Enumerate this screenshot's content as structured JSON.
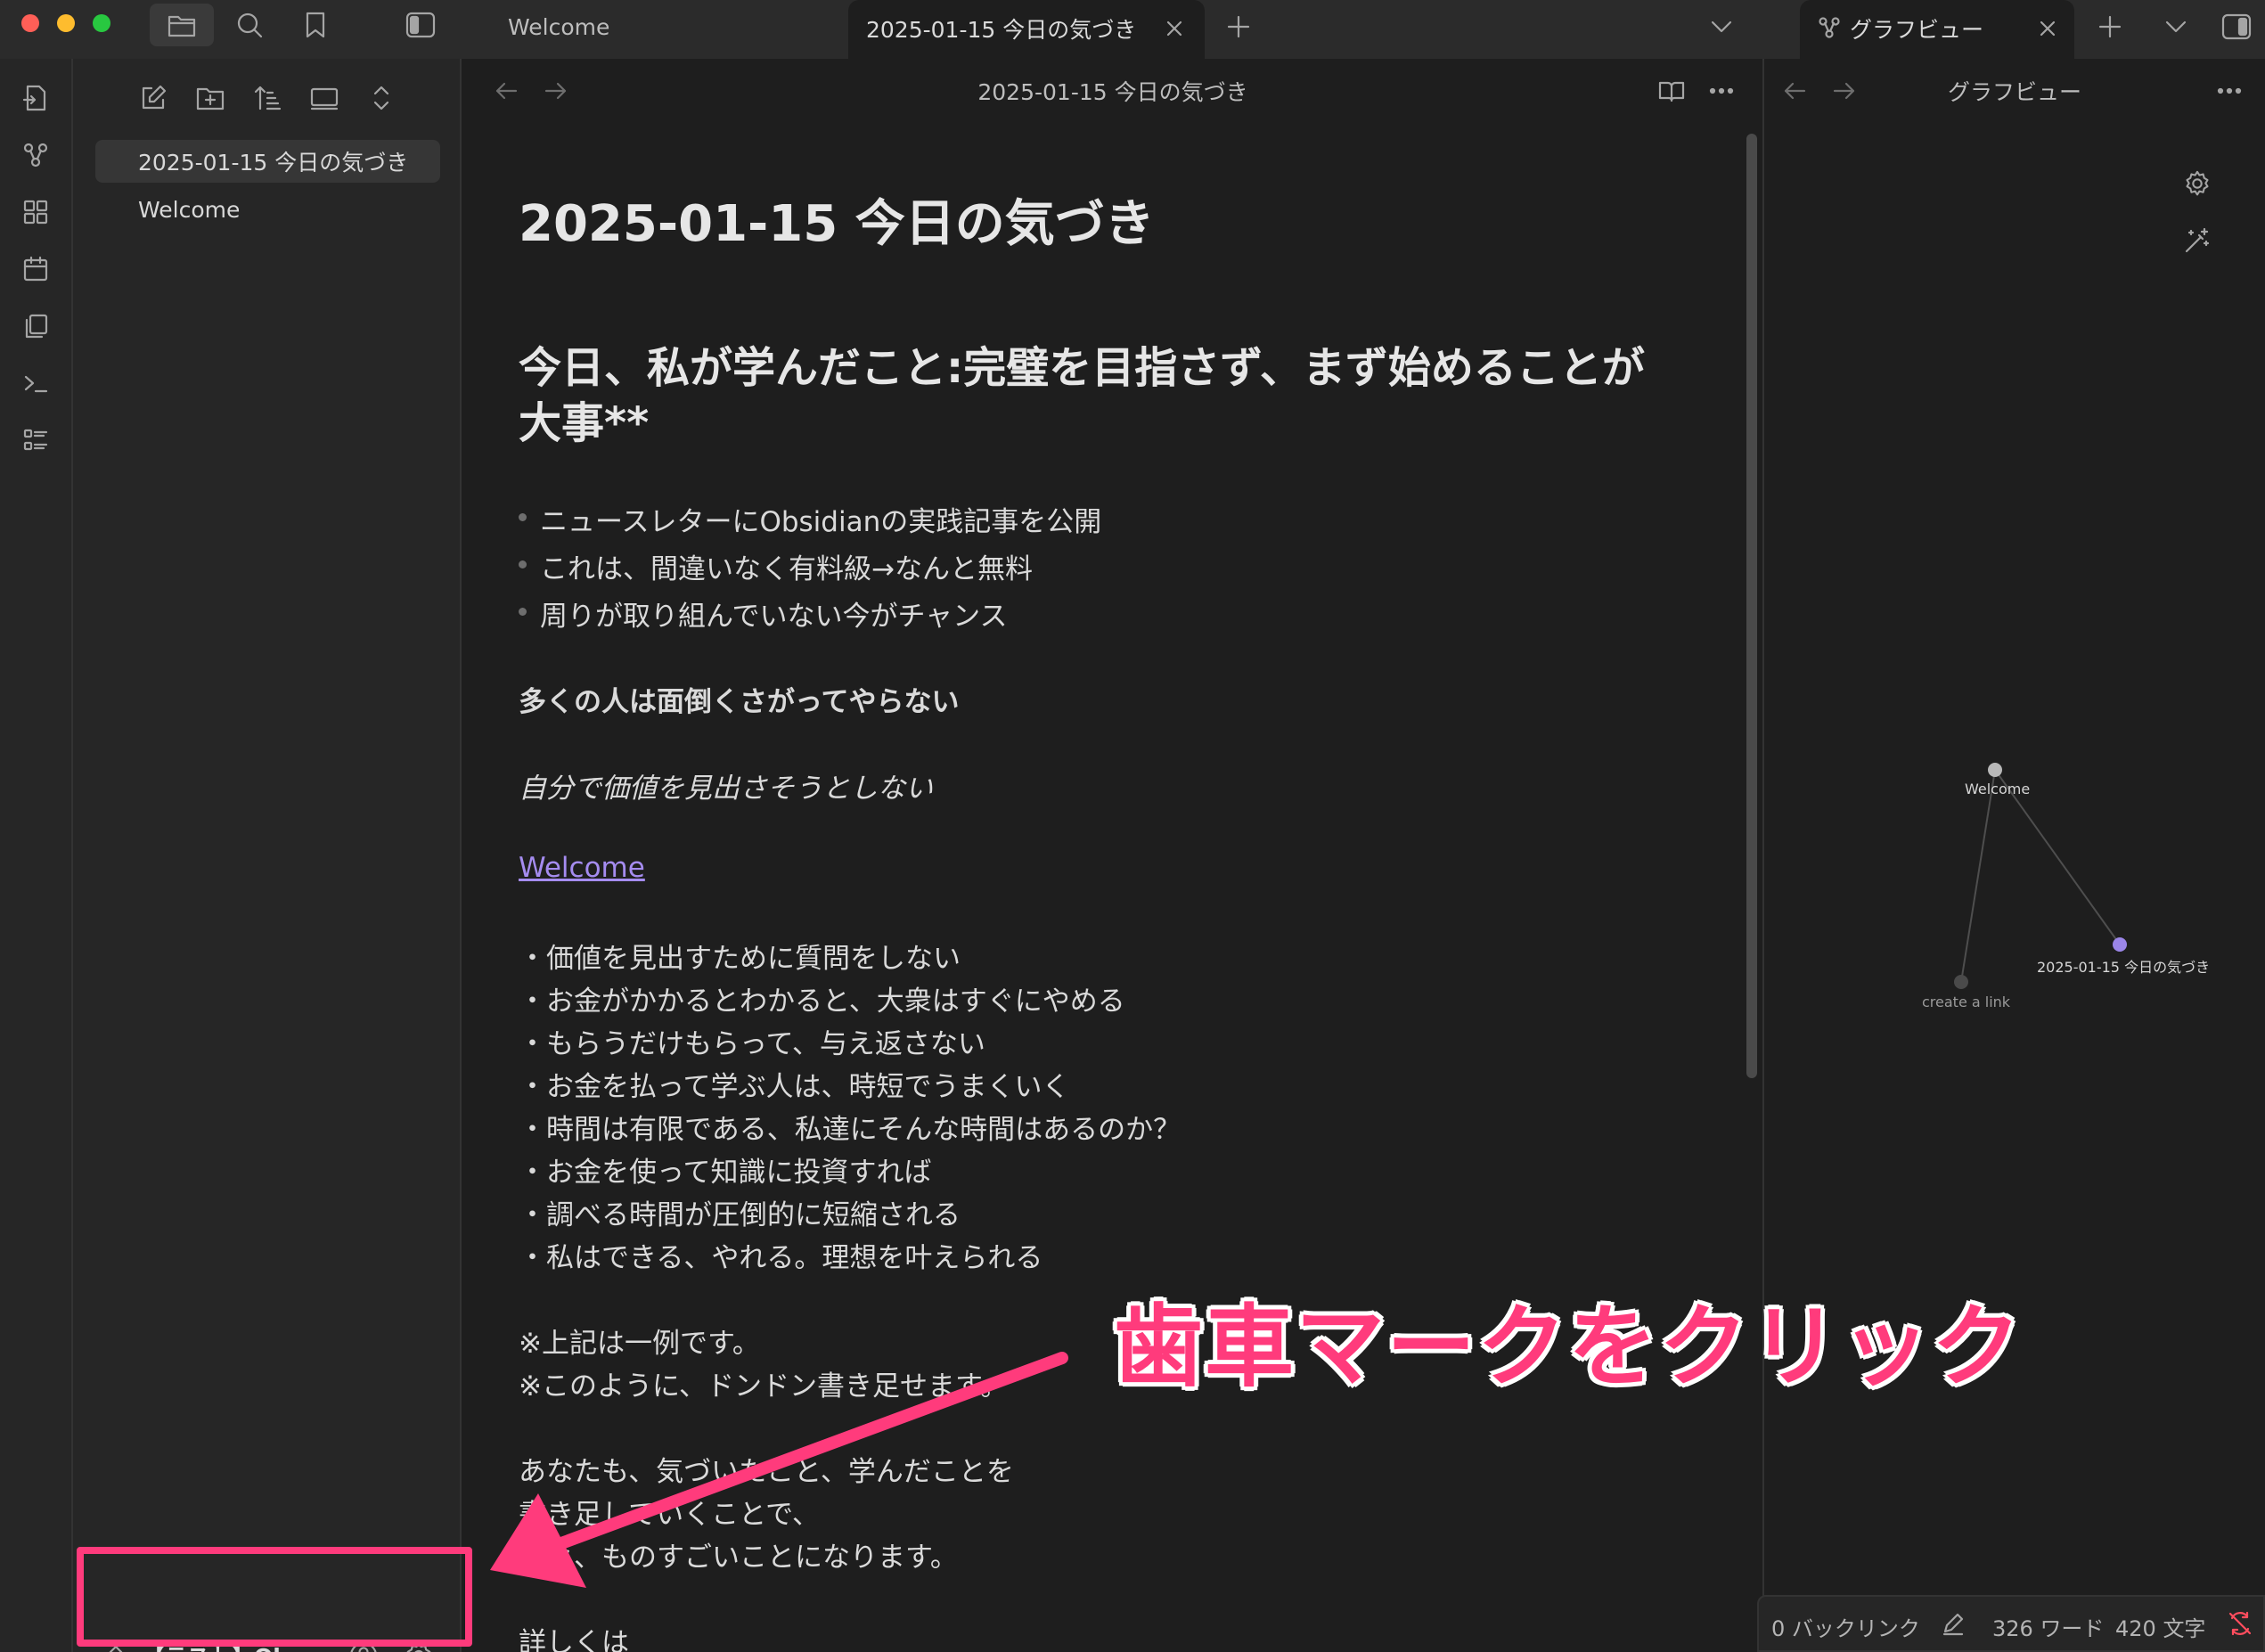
{
  "titlebar": {
    "tabs": [
      {
        "label": "Welcome"
      },
      {
        "label": "2025-01-15 今日の気づき"
      }
    ],
    "graph_tab": {
      "label": "グラフビュー"
    }
  },
  "explorer": {
    "files": [
      {
        "name": "2025-01-15 今日の気づき"
      },
      {
        "name": "Welcome"
      }
    ],
    "vault_name": "【テスト】Ob..."
  },
  "editor": {
    "header_title": "2025-01-15 今日の気づき",
    "h1": "2025-01-15 今日の気づき",
    "h2": "今日、私が学んだこと:完璧を目指さず、まず始めることが大事**",
    "bullets": [
      "ニュースレターにObsidianの実践記事を公開",
      "これは、間違いなく有料級→なんと無料",
      "周りが取り組んでいない今がチャンス"
    ],
    "bold_line": "多くの人は面倒くさがってやらない",
    "italic_line": "自分で価値を見出さそうとしない",
    "link_text": "Welcome",
    "points": [
      "・価値を見出すために質問をしない",
      "・お金がかかるとわかると、大衆はすぐにやめる",
      "・もらうだけもらって、与え返さない",
      "・お金を払って学ぶ人は、時短でうまくいく",
      "・時間は有限である、私達にそんな時間はあるのか？",
      "・お金を使って知識に投資すれば",
      "・調べる時間が圧倒的に短縮される",
      "・私はできる、やれる。理想を叶えられる"
    ],
    "notes": [
      "※上記は一例です。",
      "※このように、ドンドン書き足せます。"
    ],
    "closing": [
      "あなたも、気づいたこと、学んだことを",
      "書き足していくことで、",
      "後々、ものすごいことになります。"
    ],
    "tail": "詳しくは"
  },
  "graph": {
    "header_title": "グラフビュー",
    "nodes": [
      {
        "label": "Welcome"
      },
      {
        "label": "2025-01-15 今日の気づき"
      },
      {
        "label": "create a link"
      }
    ]
  },
  "status": {
    "backlinks": "0 バックリンク",
    "words": "326 ワード",
    "chars": "420 文字"
  },
  "annotation": {
    "callout": "歯車マークをクリック"
  },
  "colors": {
    "accent": "#a58cf0",
    "annotation": "#ff3b7c",
    "background": "#1e1e1e",
    "sidebar": "#262626"
  }
}
